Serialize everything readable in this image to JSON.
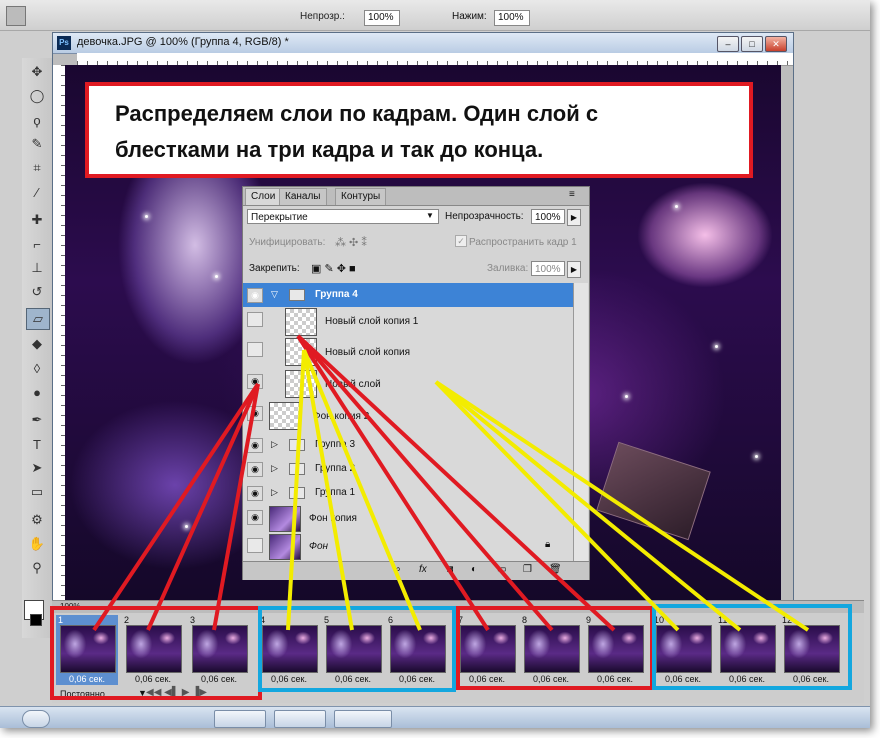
{
  "app": {
    "doc_title": "девочка.JPG @ 100% (Группа 4, RGB/8) *",
    "ps_badge": "Ps",
    "zoom_status": "100%",
    "options_fields": [
      "100%",
      "100%"
    ],
    "option_label_flow": "Нажим:"
  },
  "callout": {
    "line1": "Распределяем слои по кадрам. Один слой с",
    "line2": "блестками на три кадра и так до конца."
  },
  "layers_panel": {
    "tabs": [
      "Слои",
      "Каналы",
      "Контуры"
    ],
    "blend_mode": "Перекрытие",
    "opacity_label": "Непрозрачность:",
    "opacity_value": "100%",
    "unify_label": "Унифицировать:",
    "propagate_label": "Распространить кадр 1",
    "lock_label": "Закрепить:",
    "fill_label": "Заливка:",
    "fill_value": "100%",
    "layers": [
      {
        "name": "Группа 4",
        "kind": "group",
        "selected": true
      },
      {
        "name": "Новый слой копия 1",
        "kind": "layer"
      },
      {
        "name": "Новый слой копия",
        "kind": "layer"
      },
      {
        "name": "Новый слой",
        "kind": "layer"
      },
      {
        "name": "Фон копия 2",
        "kind": "layer"
      },
      {
        "name": "Группа 3",
        "kind": "group"
      },
      {
        "name": "Группа 2",
        "kind": "group"
      },
      {
        "name": "Группа 1",
        "kind": "group"
      },
      {
        "name": "Фон копия",
        "kind": "photo"
      },
      {
        "name": "Фон",
        "kind": "photo"
      }
    ]
  },
  "animation": {
    "loop": "Постоянно",
    "frames": [
      {
        "num": "1",
        "duration": "0,06 сек."
      },
      {
        "num": "2",
        "duration": "0,06 сек."
      },
      {
        "num": "3",
        "duration": "0,06 сек."
      },
      {
        "num": "4",
        "duration": "0,06 сек."
      },
      {
        "num": "5",
        "duration": "0,06 сек."
      },
      {
        "num": "6",
        "duration": "0,06 сек."
      },
      {
        "num": "7",
        "duration": "0,06 сек."
      },
      {
        "num": "8",
        "duration": "0,06 сек."
      },
      {
        "num": "9",
        "duration": "0,06 сек."
      },
      {
        "num": "10",
        "duration": "0,06 сек."
      },
      {
        "num": "11",
        "duration": "0,06 сек."
      },
      {
        "num": "12",
        "duration": "0,06 сек."
      }
    ]
  },
  "colors": {
    "annotation_red": "#e01a22",
    "annotation_yellow": "#f3ec00",
    "annotation_blue": "#13a7df",
    "selection_blue": "#3d83d6"
  },
  "icons": {
    "tools": [
      "move-icon",
      "marquee-icon",
      "lasso-icon",
      "quick-select-icon",
      "crop-icon",
      "eyedropper-icon",
      "healing-icon",
      "brush-icon",
      "stamp-icon",
      "history-brush-icon",
      "eraser-icon",
      "bucket-icon",
      "blur-icon",
      "dodge-icon",
      "pen-icon",
      "type-icon",
      "path-select-icon",
      "shape-icon",
      "3d-icon",
      "hand-icon",
      "zoom-icon"
    ]
  }
}
